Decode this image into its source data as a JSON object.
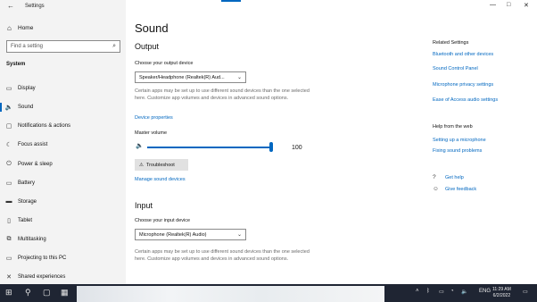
{
  "window": {
    "app_title": "Settings",
    "back_icon": "back-arrow-icon",
    "controls": [
      "minimize-icon",
      "maximize-icon",
      "close-icon"
    ],
    "minimize_glyph": "—",
    "maximize_glyph": "□",
    "close_glyph": "✕"
  },
  "sidebar": {
    "home_label": "Home",
    "search_placeholder": "Find a setting",
    "section_label": "System",
    "items": [
      {
        "label": "Display",
        "icon": "display-icon",
        "glyph": "▭"
      },
      {
        "label": "Sound",
        "icon": "speaker-icon",
        "glyph": "🔈",
        "active": true
      },
      {
        "label": "Notifications & actions",
        "icon": "notification-icon",
        "glyph": "▢"
      },
      {
        "label": "Focus assist",
        "icon": "moon-icon",
        "glyph": "☾"
      },
      {
        "label": "Power & sleep",
        "icon": "power-icon",
        "glyph": "⏻"
      },
      {
        "label": "Battery",
        "icon": "battery-icon",
        "glyph": "▭"
      },
      {
        "label": "Storage",
        "icon": "storage-icon",
        "glyph": "▬"
      },
      {
        "label": "Tablet",
        "icon": "tablet-icon",
        "glyph": "▯"
      },
      {
        "label": "Multitasking",
        "icon": "multitasking-icon",
        "glyph": "⧉"
      },
      {
        "label": "Projecting to this PC",
        "icon": "projector-icon",
        "glyph": "▭"
      },
      {
        "label": "Shared experiences",
        "icon": "shared-icon",
        "glyph": "✕"
      }
    ]
  },
  "main": {
    "title": "Sound",
    "output": {
      "heading": "Output",
      "device_label": "Choose your output device",
      "device_value": "Speaker/Headphone (Realtek(R) Aud...",
      "note": "Certain apps may be set up to use different sound devices than the one selected here. Customize app volumes and devices in advanced sound options.",
      "properties_link": "Device properties",
      "volume_label": "Master volume",
      "volume_value": "100",
      "volume_fraction": 1.0,
      "troubleshoot_label": "Troubleshoot",
      "manage_link": "Manage sound devices"
    },
    "input": {
      "heading": "Input",
      "device_label": "Choose your input device",
      "device_value": "Microphone (Realtek(R) Audio)",
      "note": "Certain apps may be set up to use different sound devices than the one selected here. Customize app volumes and devices in advanced sound options."
    }
  },
  "related": {
    "heading": "Related Settings",
    "links": [
      "Bluetooth and other devices",
      "Sound Control Panel",
      "Microphone privacy settings",
      "Ease of Access audio settings"
    ],
    "help_heading": "Help from the web",
    "help_links": [
      "Setting up a microphone",
      "Fixing sound problems"
    ],
    "get_help": "Get help",
    "feedback": "Give feedback"
  },
  "taskbar": {
    "time": "11:29 AM",
    "date": "6/2/2022",
    "language": "ENG"
  }
}
